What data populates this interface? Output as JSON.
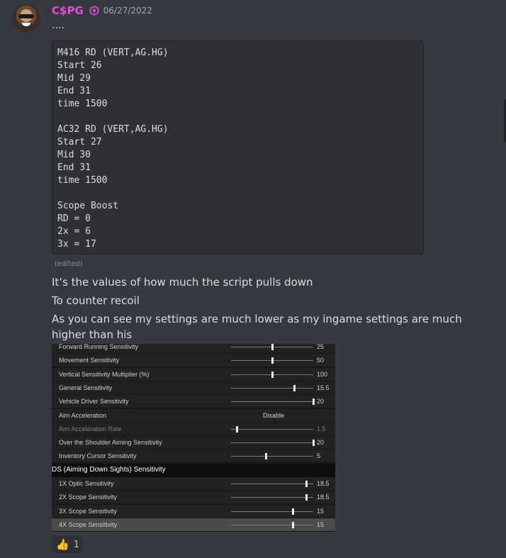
{
  "message": {
    "username": "C$PG",
    "username_color": "#e84bd7",
    "badge_icon": "server-booster-badge-icon",
    "timestamp": "06/27/2022",
    "dots": "....",
    "code_lines": [
      "M416 RD (VERT,AG.HG)",
      "Start 26",
      "Mid 29",
      "End 31",
      "time 1500",
      "",
      "AC32 RD (VERT,AG.HG)",
      "Start 27",
      "Mid 30",
      "End 31",
      "time 1500",
      "",
      "Scope Boost",
      "RD = 0",
      "2x = 6",
      "3x = 17"
    ],
    "edited_label": "(edited)",
    "texts": [
      "It’s the values of how much the script pulls down",
      "To counter recoil",
      "As you can see my settings are much lower as my ingame settings are much higher than his"
    ]
  },
  "attachment": {
    "rows": [
      {
        "label": "Forward Running Sensitivity",
        "value": "25",
        "level": 0.5
      },
      {
        "label": "Movement Sensitivity",
        "value": "50",
        "level": 0.5
      },
      {
        "label": "Vertical Sensitivity Multiplier (%)",
        "value": "100",
        "level": 0.5
      },
      {
        "label": "General Sensitivity",
        "value": "15.5",
        "level": 0.77
      },
      {
        "label": "Vehicle Driver Sensitivity",
        "value": "20",
        "level": 1.0
      },
      {
        "label": "Aim Acceleration",
        "value": "Disable"
      },
      {
        "label": "Aim Acceleration Rate",
        "value": "1.5",
        "level": 0.07
      },
      {
        "label": "Over the Shoulder Aiming Sensitivity",
        "value": "20",
        "level": 1.0
      },
      {
        "label": "Inventory Cursor Sensitivity",
        "value": "5",
        "level": 0.43
      }
    ],
    "section_header": "DS (Aiming Down Sights) Sensitivity",
    "scope_rows": [
      {
        "label": "1X Optic Sensitivity",
        "value": "18.5",
        "level": 0.92
      },
      {
        "label": "2X Scope Sensitivity",
        "value": "18.5",
        "level": 0.92
      },
      {
        "label": "3X Scope Sensitivity",
        "value": "15",
        "level": 0.75
      },
      {
        "label": "4X Scope Sensitivity",
        "value": "15",
        "level": 0.75
      }
    ]
  },
  "reaction": {
    "emoji": "👍",
    "emoji_name": "thumbs-up-icon",
    "count": "1"
  }
}
